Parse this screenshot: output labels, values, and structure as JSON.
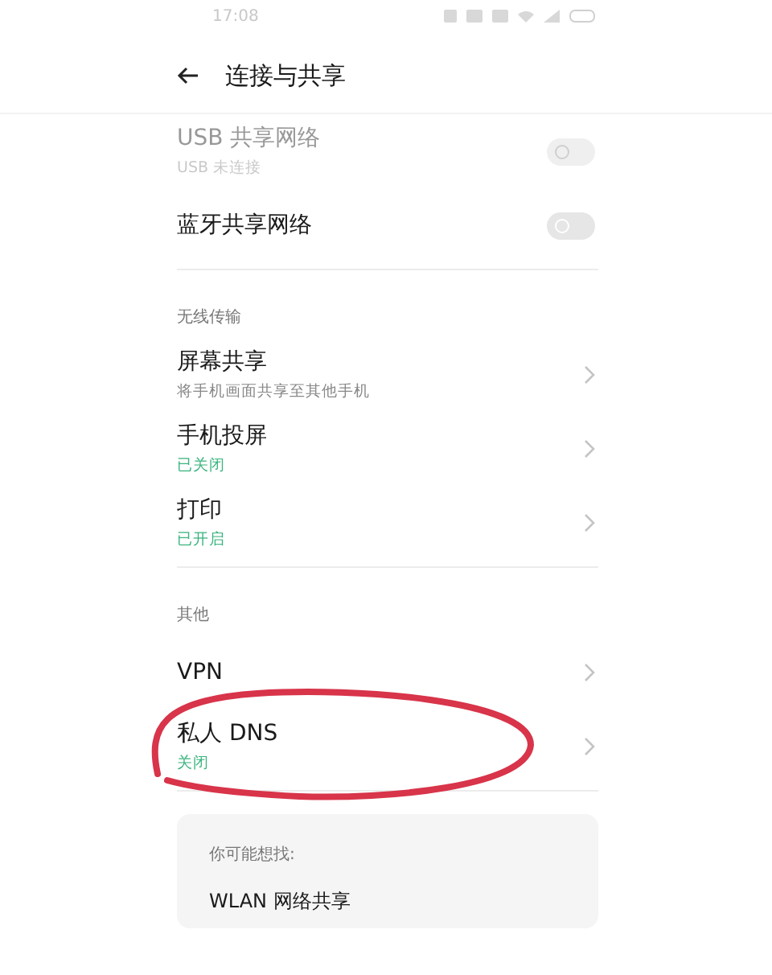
{
  "status_bar": {
    "time": "17:08"
  },
  "header": {
    "title": "连接与共享"
  },
  "groups": [
    {
      "items": [
        {
          "kind": "toggle",
          "title": "USB 共享网络",
          "subtitle": {
            "kind": "hint",
            "text": "USB 未连接"
          },
          "on": false,
          "disabled": true
        },
        {
          "kind": "toggle",
          "title": "蓝牙共享网络",
          "on": false,
          "disabled": false
        }
      ]
    },
    {
      "heading": "无线传输",
      "items": [
        {
          "kind": "link",
          "title": "屏幕共享",
          "subtitle": {
            "kind": "hint",
            "text": "将手机画面共享至其他手机"
          }
        },
        {
          "kind": "link",
          "title": "手机投屏",
          "subtitle": {
            "kind": "status",
            "text": "已关闭"
          }
        },
        {
          "kind": "link",
          "title": "打印",
          "subtitle": {
            "kind": "status",
            "text": "已开启"
          }
        }
      ]
    },
    {
      "heading": "其他",
      "items": [
        {
          "kind": "link",
          "title": "VPN"
        },
        {
          "kind": "link",
          "title": "私人 DNS",
          "subtitle": {
            "kind": "status",
            "text": "关闭"
          },
          "circled": true
        }
      ]
    }
  ],
  "suggestions": {
    "heading": "你可能想找:",
    "items": [
      "WLAN 网络共享"
    ]
  }
}
